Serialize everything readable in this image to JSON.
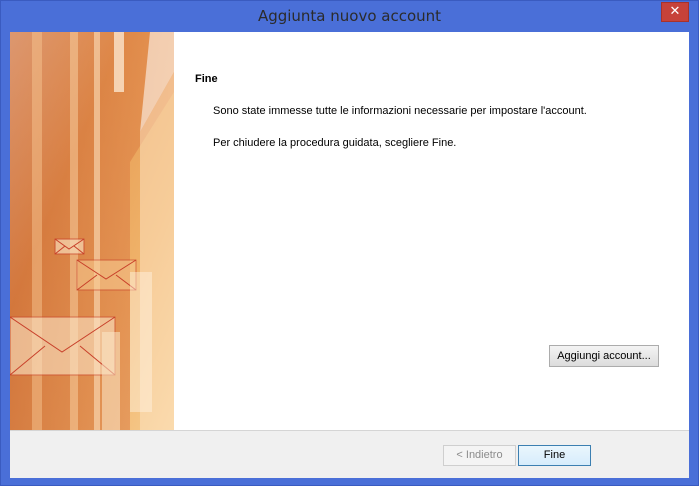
{
  "window": {
    "title": "Aggiunta nuovo account",
    "close_symbol": "✕"
  },
  "content": {
    "heading": "Fine",
    "message_line1": "Sono state immesse tutte le informazioni necessarie per impostare l'account.",
    "message_line2": "Per chiudere la procedura guidata, scegliere Fine.",
    "add_account_label": "Aggiungi account..."
  },
  "footer": {
    "back_label": "< Indietro",
    "finish_label": "Fine"
  },
  "colors": {
    "titlebar": "#4a6fd8",
    "close": "#c7423a",
    "sidebar_orange": "#e08a3a"
  }
}
